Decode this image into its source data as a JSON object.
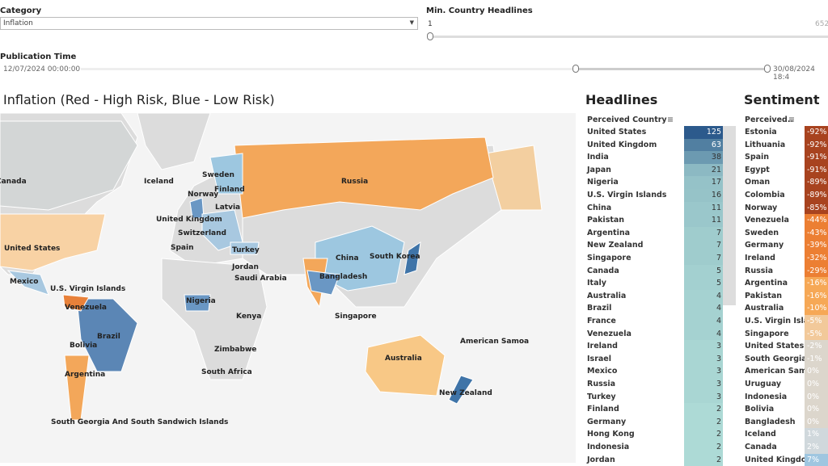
{
  "filters": {
    "category": {
      "label": "Category",
      "value": "Inflation"
    },
    "min_headlines": {
      "label": "Min. Country Headlines",
      "min": "1",
      "max": "652",
      "value": 1
    },
    "publication_time": {
      "label": "Publication Time",
      "start": "12/07/2024 00:00:00",
      "end": "30/08/2024 18:4"
    }
  },
  "map": {
    "title": "Inflation (Red - High Risk, Blue - Low Risk)",
    "labels": [
      "Canada",
      "Iceland",
      "Sweden",
      "Finland",
      "Norway",
      "Russia",
      "United Kingdom",
      "Latvia",
      "Switzerland",
      "United States",
      "Spain",
      "Turkey",
      "China",
      "South Korea",
      "Jordan",
      "Saudi Arabia",
      "Bangladesh",
      "Mexico",
      "U.S. Virgin Islands",
      "Venezuela",
      "Nigeria",
      "Brazil",
      "Kenya",
      "Singapore",
      "Bolivia",
      "Zimbabwe",
      "American Samoa",
      "Australia",
      "South Africa",
      "Argentina",
      "New Zealand",
      "South Georgia And South Sandwich Islands"
    ]
  },
  "headlines": {
    "title": "Headlines",
    "column": "Perceived Country",
    "rows": [
      [
        "United States",
        "125"
      ],
      [
        "United Kingdom",
        "63"
      ],
      [
        "India",
        "38"
      ],
      [
        "Japan",
        "21"
      ],
      [
        "Nigeria",
        "17"
      ],
      [
        "U.S. Virgin Islands",
        "16"
      ],
      [
        "China",
        "11"
      ],
      [
        "Pakistan",
        "11"
      ],
      [
        "Argentina",
        "7"
      ],
      [
        "New Zealand",
        "7"
      ],
      [
        "Singapore",
        "7"
      ],
      [
        "Canada",
        "5"
      ],
      [
        "Italy",
        "5"
      ],
      [
        "Australia",
        "4"
      ],
      [
        "Brazil",
        "4"
      ],
      [
        "France",
        "4"
      ],
      [
        "Venezuela",
        "4"
      ],
      [
        "Ireland",
        "3"
      ],
      [
        "Israel",
        "3"
      ],
      [
        "Mexico",
        "3"
      ],
      [
        "Russia",
        "3"
      ],
      [
        "Turkey",
        "3"
      ],
      [
        "Finland",
        "2"
      ],
      [
        "Germany",
        "2"
      ],
      [
        "Hong Kong",
        "2"
      ],
      [
        "Indonesia",
        "2"
      ],
      [
        "Jordan",
        "2"
      ]
    ]
  },
  "sentiment": {
    "title": "Sentiment",
    "column": "Perceived..",
    "rows": [
      [
        "Estonia",
        "-92%"
      ],
      [
        "Lithuania",
        "-92%"
      ],
      [
        "Spain",
        "-91%"
      ],
      [
        "Egypt",
        "-91%"
      ],
      [
        "Oman",
        "-89%"
      ],
      [
        "Colombia",
        "-89%"
      ],
      [
        "Norway",
        "-85%"
      ],
      [
        "Venezuela",
        "-44%"
      ],
      [
        "Sweden",
        "-43%"
      ],
      [
        "Germany",
        "-39%"
      ],
      [
        "Ireland",
        "-32%"
      ],
      [
        "Russia",
        "-29%"
      ],
      [
        "Argentina",
        "-16%"
      ],
      [
        "Pakistan",
        "-16%"
      ],
      [
        "Australia",
        "-10%"
      ],
      [
        "U.S. Virgin Isla..",
        "-5%"
      ],
      [
        "Singapore",
        "-5%"
      ],
      [
        "United States",
        "-2%"
      ],
      [
        "South Georgia ..",
        "-1%"
      ],
      [
        "American Samoa",
        "0%"
      ],
      [
        "Uruguay",
        "0%"
      ],
      [
        "Indonesia",
        "0%"
      ],
      [
        "Bolivia",
        "0%"
      ],
      [
        "Bangladesh",
        "0%"
      ],
      [
        "Iceland",
        "1%"
      ],
      [
        "Canada",
        "2%"
      ],
      [
        "United Kingdom",
        "7%"
      ]
    ]
  }
}
